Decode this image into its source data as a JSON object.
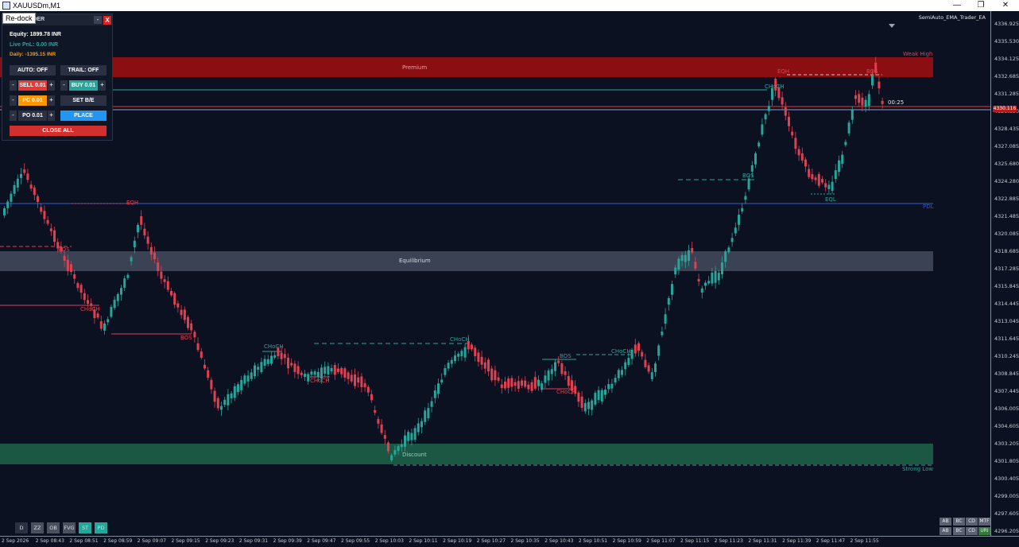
{
  "window": {
    "title": "XAUUSDm,M1",
    "minimize": "—",
    "restore": "❐",
    "close": "✕"
  },
  "ea_name": "SemiAuto_EMA_Trader_EA",
  "panel": {
    "redock": "Re-dock",
    "title": "TRADER",
    "min_label": "-",
    "close_label": "X",
    "equity": "Equity: 1899.78 INR",
    "live_pnl": "Live PnL: 0.00 INR",
    "daily": "Daily: -1395.15 INR",
    "auto_label": "AUTO: OFF",
    "trail_label": "TRAIL: OFF",
    "sell_label": "SELL 0.01",
    "buy_label": "BUY 0.01",
    "pc_label": "PC 0.01",
    "setbe_label": "SET B/E",
    "po_label": "PO 0.01",
    "place_label": "PLACE",
    "close_all_label": "CLOSE ALL",
    "minus": "-",
    "plus": "+",
    "colors": {
      "sell": "#e53935",
      "buy": "#26a69a",
      "pc": "#ff9800",
      "place": "#2196f3",
      "close_all": "#d32f2f",
      "dark_btn": "#2b3142"
    }
  },
  "zones": {
    "premium": "Premium",
    "equilibrium": "Equilibrium",
    "discount": "Discount",
    "weak_high": "Weak High",
    "strong_low": "Strong Low",
    "pdl": "PDL"
  },
  "structure_labels": {
    "eqh_left": "EQH",
    "bos_1": "BOS",
    "choch_1": "CHoCH",
    "bos_2": "BOS",
    "choch_2": "CHoCH",
    "choch_3": "CHoCH",
    "choch_4": "CHoCH",
    "bos_3": "BOS",
    "choch_5": "CHoCH",
    "choch_6": "CHoCH",
    "bos_4": "BOS",
    "eqh_right": "EQH",
    "choch_7": "CHoCH",
    "bos_5": "BOS",
    "eql": "EQL"
  },
  "countdown": "00:25",
  "current_price": "4330.116",
  "price_ticks": [
    "4336.925",
    "4335.530",
    "4334.125",
    "4332.685",
    "4331.285",
    "4329.880",
    "4328.435",
    "4327.085",
    "4325.680",
    "4324.280",
    "4322.885",
    "4321.485",
    "4320.085",
    "4318.685",
    "4317.285",
    "4315.845",
    "4314.445",
    "4313.045",
    "4311.645",
    "4310.245",
    "4308.845",
    "4307.445",
    "4306.005",
    "4304.605",
    "4303.205",
    "4301.805",
    "4300.405",
    "4299.005",
    "4297.605",
    "4296.205"
  ],
  "time_ticks": [
    "2 Sep 2026",
    "2 Sep 08:43",
    "2 Sep 08:51",
    "2 Sep 08:59",
    "2 Sep 09:07",
    "2 Sep 09:15",
    "2 Sep 09:23",
    "2 Sep 09:31",
    "2 Sep 09:39",
    "2 Sep 09:47",
    "2 Sep 09:55",
    "2 Sep 10:03",
    "2 Sep 10:11",
    "2 Sep 10:19",
    "2 Sep 10:27",
    "2 Sep 10:35",
    "2 Sep 10:43",
    "2 Sep 10:51",
    "2 Sep 10:59",
    "2 Sep 11:07",
    "2 Sep 11:15",
    "2 Sep 11:23",
    "2 Sep 11:31",
    "2 Sep 11:39",
    "2 Sep 11:47",
    "2 Sep 11:55"
  ],
  "toggles": [
    {
      "label": "D",
      "color": "#2b3142"
    },
    {
      "label": "ZZ",
      "color": "#4a505e"
    },
    {
      "label": "OB",
      "color": "#4a505e"
    },
    {
      "label": "FVG",
      "color": "#4a505e"
    },
    {
      "label": "ST",
      "color": "#26a69a"
    },
    {
      "label": "PD",
      "color": "#26a69a"
    }
  ],
  "tf_row1": [
    "AB",
    "BC",
    "CD",
    "MTF"
  ],
  "tf_row2": [
    "AB",
    "BC",
    "CD",
    "URI"
  ],
  "colors": {
    "bull": "#26a69a",
    "bear": "#e04050",
    "premium": "#8b0f12",
    "equilibrium": "#3a4254",
    "discount": "#1b5843",
    "pdl": "#2d5bd8"
  },
  "price_range": [
    4296.2,
    4337.6
  ]
}
